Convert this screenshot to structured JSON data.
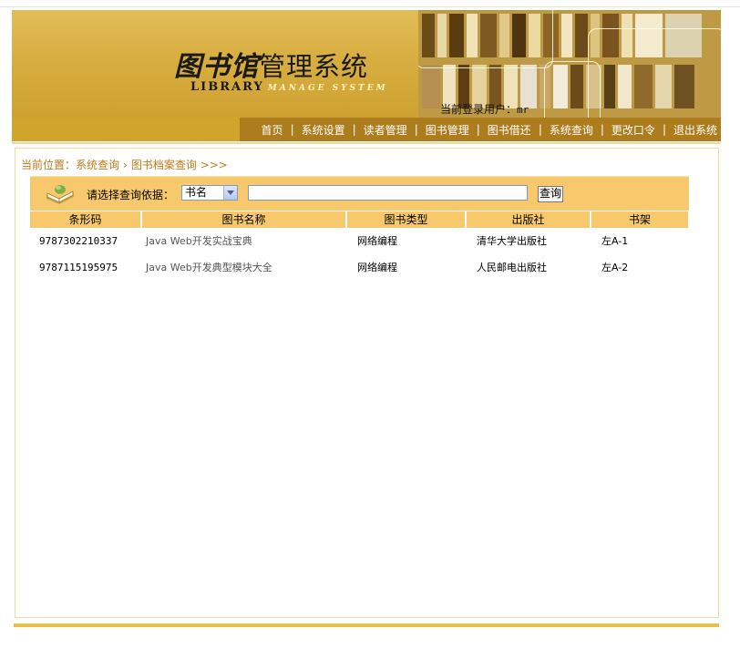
{
  "banner": {
    "logo_cn_big": "图书馆",
    "logo_cn_rest": "管理系统",
    "logo_en_library": "LIBRARY",
    "logo_en_manage": "MANAGE SYSTEM",
    "user_label": "当前登录用户：",
    "user_name": "mr"
  },
  "nav": {
    "items": [
      "首页",
      "系统设置",
      "读者管理",
      "图书管理",
      "图书借还",
      "系统查询",
      "更改口令",
      "退出系统"
    ],
    "separator": "|"
  },
  "breadcrumb": {
    "prefix": "当前位置：",
    "level1": "系统查询",
    "level2": "图书档案查询",
    "suffix": ">>>"
  },
  "search": {
    "label": "请选择查询依据：",
    "select_value": "书名",
    "input_value": "",
    "button_label": "查询"
  },
  "table": {
    "headers": [
      "条形码",
      "图书名称",
      "图书类型",
      "出版社",
      "书架"
    ],
    "rows": [
      [
        "9787302210337",
        "Java Web开发实战宝典",
        "网络编程",
        "清华大学出版社",
        "左A-1"
      ],
      [
        "9787115195975",
        "Java Web开发典型模块大全",
        "网络编程",
        "人民邮电出版社",
        "左A-2"
      ]
    ]
  },
  "colors": {
    "banner_gold": "#d8ae40",
    "nav_brown": "#ad7c1c",
    "header_gold": "#f7c96c",
    "breadcrumb_orange": "#c07a1a"
  }
}
